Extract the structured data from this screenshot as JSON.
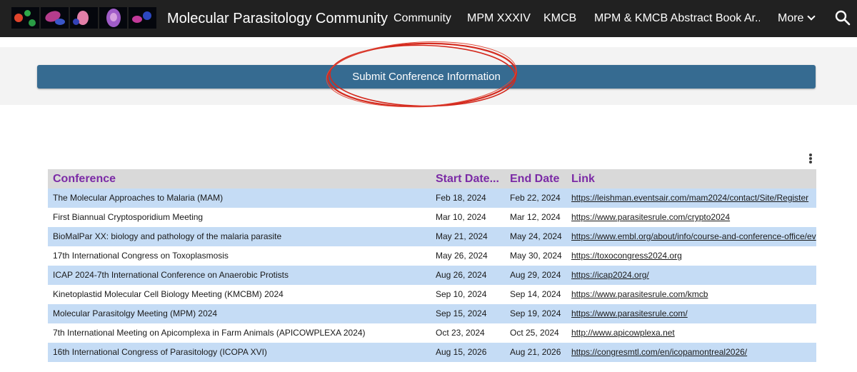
{
  "header": {
    "site_title": "Molecular Parasitology Community",
    "nav_items": [
      "Community",
      "MPM XXXIV",
      "KMCB",
      "MPM & KMCB Abstract Book Ar..."
    ],
    "more_label": "More",
    "search_icon": "search-icon",
    "logo_tiles": [
      "logo-tile-1",
      "logo-tile-2",
      "logo-tile-3",
      "logo-tile-4",
      "logo-tile-5"
    ],
    "bar_color": "#212121"
  },
  "banner": {
    "submit_label": "Submit Conference Information",
    "button_color": "#366b91",
    "annotation_color": "#d42a1e"
  },
  "table": {
    "menu_icon": "kebab-menu-icon",
    "headers": [
      "Conference",
      "Start Date...",
      "End Date",
      "Link"
    ],
    "header_color": "#7b2aa6",
    "row_highlight": "#c5dcf5",
    "rows": [
      {
        "conference": "The Molecular Approaches to Malaria (MAM)",
        "start": "Feb 18, 2024",
        "end": "Feb 22, 2024",
        "link": "https://leishman.eventsair.com/mam2024/contact/Site/Register"
      },
      {
        "conference": "First Biannual Cryptosporidium Meeting",
        "start": "Mar 10, 2024",
        "end": "Mar 12, 2024",
        "link": "https://www.parasitesrule.com/crypto2024"
      },
      {
        "conference": "BioMalPar XX: biology and pathology of the malaria parasite",
        "start": "May 21, 2024",
        "end": "May 24, 2024",
        "link": "https://www.embl.org/about/info/course-and-conference-office/ev"
      },
      {
        "conference": "17th International Congress on Toxoplasmosis",
        "start": "May 26, 2024",
        "end": "May 30, 2024",
        "link": "https://toxocongress2024.org"
      },
      {
        "conference": "ICAP 2024-7th International Conference on Anaerobic Protists",
        "start": "Aug 26, 2024",
        "end": "Aug 29, 2024",
        "link": "https://icap2024.org/"
      },
      {
        "conference": "Kinetoplastid Molecular Cell Biology Meeting (KMCBM) 2024",
        "start": "Sep 10, 2024",
        "end": "Sep 14, 2024",
        "link": "https://www.parasitesrule.com/kmcb"
      },
      {
        "conference": "Molecular Parasitolgy Meeting (MPM) 2024",
        "start": "Sep 15, 2024",
        "end": "Sep 19, 2024",
        "link": "https://www.parasitesrule.com/"
      },
      {
        "conference": "7th International Meeting on Apicomplexa in Farm Animals (APICOWPLEXA 2024)",
        "start": "Oct 23, 2024",
        "end": "Oct 25, 2024",
        "link": "http://www.apicowplexa.net"
      },
      {
        "conference": "16th International Congress of Parasitology (ICOPA XVI)",
        "start": "Aug 15, 2026",
        "end": "Aug 21, 2026",
        "link": "https://congresmtl.com/en/icopamontreal2026/"
      }
    ]
  }
}
